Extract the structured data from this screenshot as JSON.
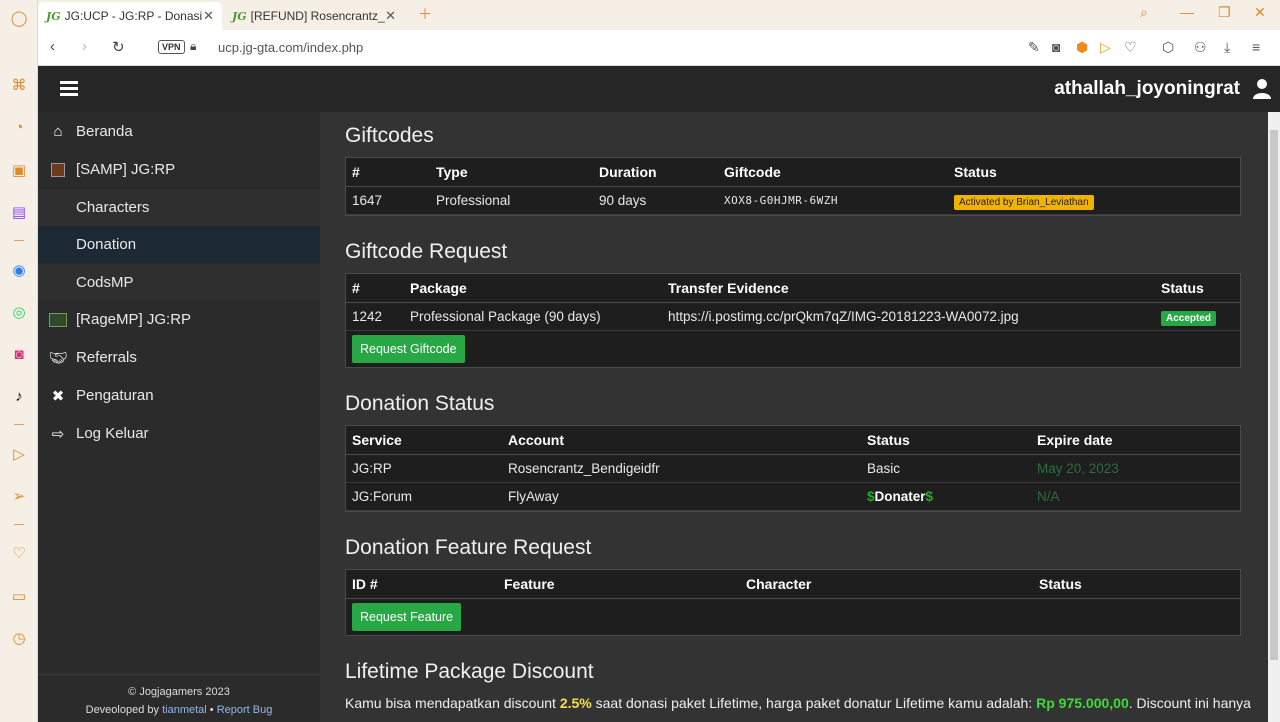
{
  "browser": {
    "tabs": [
      {
        "favicon": "JG",
        "title": "JG:UCP - JG:RP - Donasi"
      },
      {
        "favicon": "JG",
        "title": "[REFUND] Rosencrantz_Beni"
      }
    ],
    "vpn_label": "VPN",
    "url": "ucp.jg-gta.com/index.php"
  },
  "header": {
    "username": "athallah_joyoningrat"
  },
  "sidebar": {
    "items": [
      {
        "label": "Beranda",
        "icon": "home-icon"
      },
      {
        "label": "[SAMP] JG:RP",
        "icon": "samp-icon"
      },
      {
        "label": "Characters"
      },
      {
        "label": "Donation"
      },
      {
        "label": "CodsMP"
      },
      {
        "label": "[RageMP] JG:RP",
        "icon": "ragemp-icon"
      },
      {
        "label": "Referrals",
        "icon": "handshake-icon"
      },
      {
        "label": "Pengaturan",
        "icon": "tools-icon"
      },
      {
        "label": "Log Keluar",
        "icon": "logout-icon"
      }
    ],
    "footer": {
      "copyright": "© Jogjagamers 2023",
      "developed_prefix": "Deveoloped by",
      "developer": "tianmetal",
      "separator": "•",
      "report_bug": "Report Bug"
    }
  },
  "giftcodes": {
    "title": "Giftcodes",
    "columns": [
      "#",
      "Type",
      "Duration",
      "Giftcode",
      "Status"
    ],
    "rows": [
      {
        "id": "1647",
        "type": "Professional",
        "duration": "90 days",
        "code": "XOX8-G0HJMR-6WZH",
        "status": "Activated by Brian_Leviathan"
      }
    ]
  },
  "giftcode_request": {
    "title": "Giftcode Request",
    "columns": [
      "#",
      "Package",
      "Transfer Evidence",
      "Status"
    ],
    "rows": [
      {
        "id": "1242",
        "package": "Professional Package (90 days)",
        "evidence": "https://i.postimg.cc/prQkm7qZ/IMG-20181223-WA0072.jpg",
        "status": "Accepted"
      }
    ],
    "button": "Request Giftcode"
  },
  "donation_status": {
    "title": "Donation Status",
    "columns": [
      "Service",
      "Account",
      "Status",
      "Expire date"
    ],
    "rows": [
      {
        "service": "JG:RP",
        "account": "Rosencrantz_Bendigeidfr",
        "status": "Basic",
        "expire": "May 20, 2023"
      },
      {
        "service": "JG:Forum",
        "account": "FlyAway",
        "status_prefix": "$",
        "status_word": "Donater",
        "status_suffix": "$",
        "expire": "N/A"
      }
    ]
  },
  "feature_request": {
    "title": "Donation Feature Request",
    "columns": [
      "ID #",
      "Feature",
      "Character",
      "Status"
    ],
    "button": "Request Feature"
  },
  "lifetime": {
    "title": "Lifetime Package Discount",
    "text_1": "Kamu bisa mendapatkan discount ",
    "discount": "2.5%",
    "text_2": " saat donasi paket Lifetime, harga paket donatur Lifetime kamu adalah: ",
    "price": "Rp 975.000,00",
    "text_3": ". Discount ini hanya"
  },
  "colors": {
    "accent_green": "#28a745",
    "badge_yellow": "#f0b400",
    "header_bg": "#262626",
    "sidebar_bg": "#2b2b2b",
    "content_bg": "#333333"
  }
}
